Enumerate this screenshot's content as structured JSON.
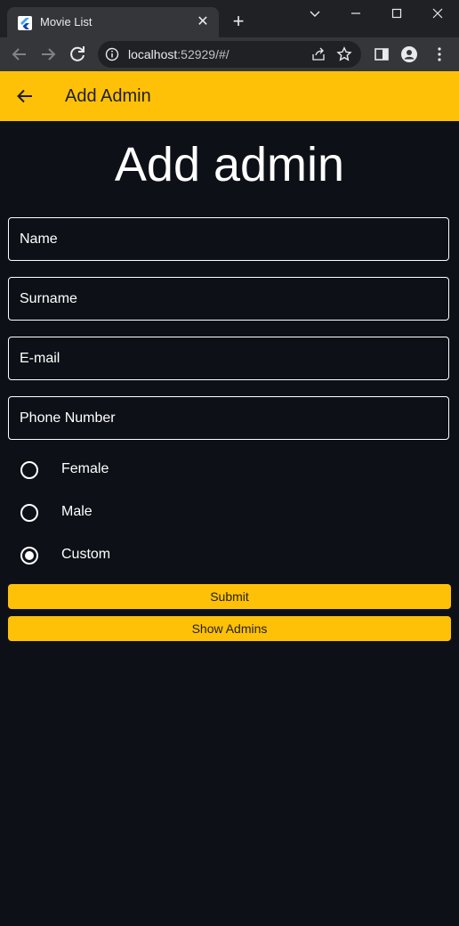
{
  "browser": {
    "tab_title": "Movie List",
    "new_tab_symbol": "+",
    "url_host": "localhost",
    "url_rest": ":52929/#/"
  },
  "appbar": {
    "title": "Add Admin",
    "color": "#ffc107"
  },
  "form": {
    "heading": "Add admin",
    "fields": [
      {
        "label": "Name"
      },
      {
        "label": "Surname"
      },
      {
        "label": "E-mail"
      },
      {
        "label": "Phone Number"
      }
    ],
    "gender_options": [
      {
        "label": "Female",
        "selected": false
      },
      {
        "label": "Male",
        "selected": false
      },
      {
        "label": "Custom",
        "selected": true
      }
    ],
    "submit_label": "Submit",
    "show_admins_label": "Show Admins"
  },
  "icons": {
    "back": "arrow-back-icon",
    "radio": "radio-button-icon"
  }
}
